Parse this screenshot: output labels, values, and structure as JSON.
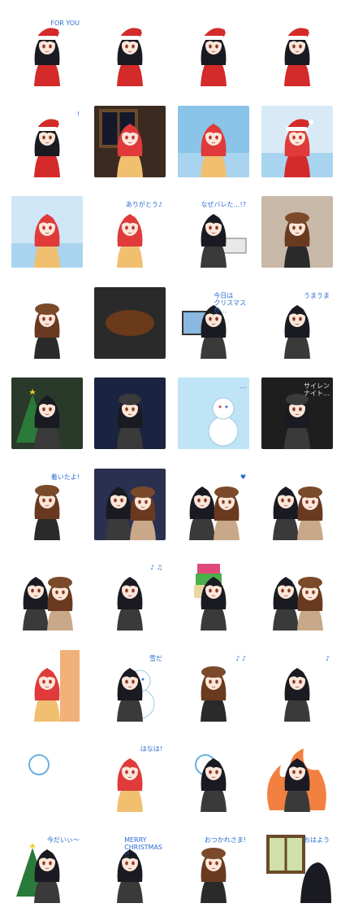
{
  "sheet": {
    "columns": 4,
    "rows": 10
  },
  "stickers": [
    {
      "scene": "santa-girl-gift-bag",
      "caption": "FOR YOU",
      "bg": "#ffffff",
      "accent": "#d42a2a"
    },
    {
      "scene": "santa-girl-sweat",
      "caption": "",
      "bg": "#ffffff",
      "accent": "#d42a2a"
    },
    {
      "scene": "santa-girl-back-sack",
      "caption": "",
      "bg": "#ffffff",
      "accent": "#d42a2a"
    },
    {
      "scene": "santa-girl-dots",
      "caption": "",
      "bg": "#ffffff",
      "accent": "#d42a2a"
    },
    {
      "scene": "santa-girl-chimney",
      "caption": "!",
      "bg": "#ffffff",
      "accent": "#b0503a"
    },
    {
      "scene": "window-night-redhead",
      "caption": "",
      "bg": "#3a2a20",
      "accent": "#e03a3a"
    },
    {
      "scene": "redhead-blanket",
      "caption": "",
      "bg": "#8ac4e8",
      "accent": "#e03a3a"
    },
    {
      "scene": "santa-girl-sleeping-redhead",
      "caption": "",
      "bg": "#d8eaf6",
      "accent": "#d42a2a"
    },
    {
      "scene": "redhead-waking",
      "caption": "",
      "bg": "#cfe6f6",
      "accent": "#e03a3a"
    },
    {
      "scene": "redhead-thanks",
      "caption": "ありがとう♪",
      "bg": "#ffffff",
      "accent": "#e03a3a"
    },
    {
      "scene": "office-girl-printer",
      "caption": "なぜバレた…!?",
      "bg": "#ffffff",
      "accent": "#3a5a9a"
    },
    {
      "scene": "beret-girl-gift",
      "caption": "",
      "bg": "#c8b8a8",
      "accent": "#7a4a2a"
    },
    {
      "scene": "beret-girl-card",
      "caption": "",
      "bg": "#ffffff",
      "accent": "#7a4a2a"
    },
    {
      "scene": "beret-closeup-dark",
      "caption": "",
      "bg": "#2a2a2a",
      "accent": "#6a3a1a"
    },
    {
      "scene": "computer-santa-hat",
      "caption": "今日は\nクリスマス\nか…",
      "bg": "#ffffff",
      "accent": "#d42a2a"
    },
    {
      "scene": "girl-lying-cookie",
      "caption": "うまうま",
      "bg": "#ffffff",
      "accent": "#333333"
    },
    {
      "scene": "christmas-tree-snow",
      "caption": "",
      "bg": "#2a3a2a",
      "accent": "#3a8a3a"
    },
    {
      "scene": "girl-bench-snow",
      "caption": "",
      "bg": "#1a2440",
      "accent": "#5a4a3a"
    },
    {
      "scene": "snowman-ellipsis",
      "caption": "…",
      "bg": "#bfe4f6",
      "accent": "#ffffff"
    },
    {
      "scene": "silent-night",
      "caption": "サイレン\nナイト…",
      "bg": "#1e1e1e",
      "accent": "#e8b040"
    },
    {
      "scene": "beret-girl-arrived",
      "caption": "着いたよ!",
      "bg": "#ffffff",
      "accent": "#7a4a2a"
    },
    {
      "scene": "two-girls-night-gift",
      "caption": "",
      "bg": "#2a3050",
      "accent": "#e8c030"
    },
    {
      "scene": "two-girls-heart",
      "caption": "♥",
      "bg": "#ffffff",
      "accent": "#e86a8a"
    },
    {
      "scene": "two-girls-sweat",
      "caption": "",
      "bg": "#ffffff",
      "accent": "#5a5a5a"
    },
    {
      "scene": "girls-hug",
      "caption": "",
      "bg": "#ffffff",
      "accent": "#3a3a3a"
    },
    {
      "scene": "girl-music-notes",
      "caption": "♪ ♫",
      "bg": "#ffffff",
      "accent": "#f0c020"
    },
    {
      "scene": "girl-stacked-gifts",
      "caption": "",
      "bg": "#ffffff",
      "accent": "#e03a3a"
    },
    {
      "scene": "girls-eating",
      "caption": "",
      "bg": "#ffffff",
      "accent": "#d08a30"
    },
    {
      "scene": "redhead-door-peek",
      "caption": "",
      "bg": "#ffffff",
      "accent": "#f2b07a"
    },
    {
      "scene": "snowman-girl",
      "caption": "雪だ",
      "bg": "#ffffff",
      "accent": "#2a9ad8"
    },
    {
      "scene": "beret-girl-singing",
      "caption": "♪ ♪",
      "bg": "#ffffff",
      "accent": "#d42a2a"
    },
    {
      "scene": "girl-microphone",
      "caption": "♪",
      "bg": "#ffffff",
      "accent": "#333333"
    },
    {
      "scene": "snowball-hit",
      "caption": "",
      "bg": "#ffffff",
      "accent": "#6ab0e0"
    },
    {
      "scene": "redhead-pointing",
      "caption": "はなは!",
      "bg": "#ffffff",
      "accent": "#e03a3a"
    },
    {
      "scene": "snowball-chibi",
      "caption": "",
      "bg": "#ffffff",
      "accent": "#e03a3a"
    },
    {
      "scene": "fire-girl-chair",
      "caption": "",
      "bg": "#ffffff",
      "accent": "#f05020"
    },
    {
      "scene": "tree-star-girl",
      "caption": "今だいぃ〜",
      "bg": "#ffffff",
      "accent": "#2a8a3a"
    },
    {
      "scene": "merry-christmas-group",
      "caption": "MERRY\nCHRISTMAS\n!!",
      "bg": "#ffffff",
      "accent": "#d42a2a"
    },
    {
      "scene": "beret-girl-goodnight",
      "caption": "おつかれさま!",
      "bg": "#ffffff",
      "accent": "#7a4a2a"
    },
    {
      "scene": "window-sunrise",
      "caption": "おはよう",
      "bg": "#ffffff",
      "accent": "#e8c070"
    }
  ]
}
